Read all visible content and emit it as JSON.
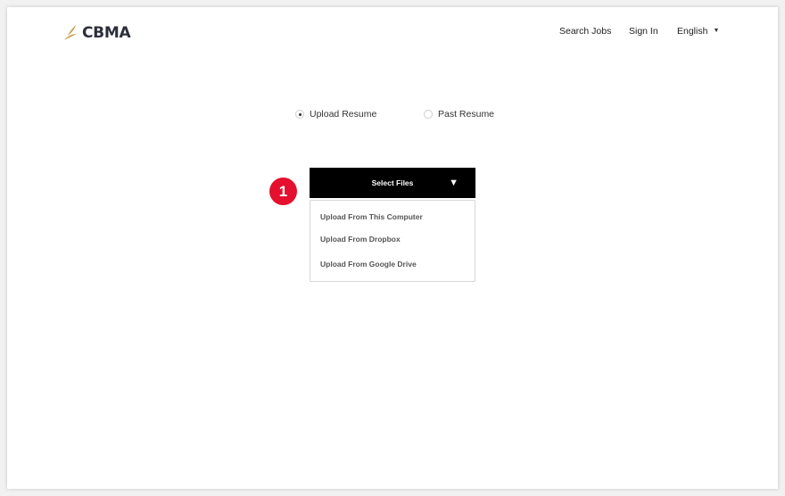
{
  "header": {
    "logo_text": "CBMA",
    "nav": {
      "search_jobs": "Search Jobs",
      "sign_in": "Sign In",
      "language": "English"
    }
  },
  "upload_options": {
    "upload_resume": {
      "label": "Upload Resume",
      "selected": true
    },
    "past_resume": {
      "label": "Past Resume",
      "selected": false
    }
  },
  "step_badge": "1",
  "select_files": {
    "label": "Select Files",
    "menu": [
      "Upload From This Computer",
      "Upload From Dropbox",
      "Upload From Google Drive"
    ]
  },
  "colors": {
    "logo_gold": "#c8a04f",
    "logo_text": "#2b2f3a",
    "badge_red": "#e4102d",
    "button_black": "#000000"
  }
}
